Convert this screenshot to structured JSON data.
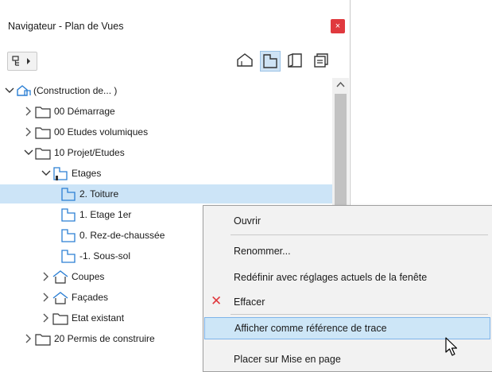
{
  "panel": {
    "title": "Navigateur - Plan de Vues",
    "close_label": "×"
  },
  "tree": {
    "root_label": "(Construction de... )",
    "items": [
      {
        "label": "00 Démarrage"
      },
      {
        "label": "00 Etudes volumiques"
      },
      {
        "label": "10 Projet/Etudes"
      },
      {
        "label": "Etages"
      },
      {
        "label": "2. Toiture"
      },
      {
        "label": "1. Etage 1er"
      },
      {
        "label": "0. Rez-de-chaussée"
      },
      {
        "label": "-1. Sous-sol"
      },
      {
        "label": "Coupes"
      },
      {
        "label": "Façades"
      },
      {
        "label": "Etat existant"
      },
      {
        "label": "20 Permis de construire"
      }
    ],
    "selected_item": "2. Toiture"
  },
  "context_menu": {
    "items": [
      {
        "label": "Ouvrir"
      },
      {
        "label": "Renommer..."
      },
      {
        "label": "Redéfinir avec réglages actuels de la fenête"
      },
      {
        "label": "Effacer",
        "icon": "delete-x-icon"
      },
      {
        "label": "Afficher comme référence de trace",
        "highlighted": true
      },
      {
        "label": "Placer sur Mise en page"
      }
    ]
  },
  "colors": {
    "selection": "#cce4f7",
    "menu_highlight": "#cde6f7",
    "close_button": "#e0393e",
    "folder_icon": "#2b7fd4"
  }
}
